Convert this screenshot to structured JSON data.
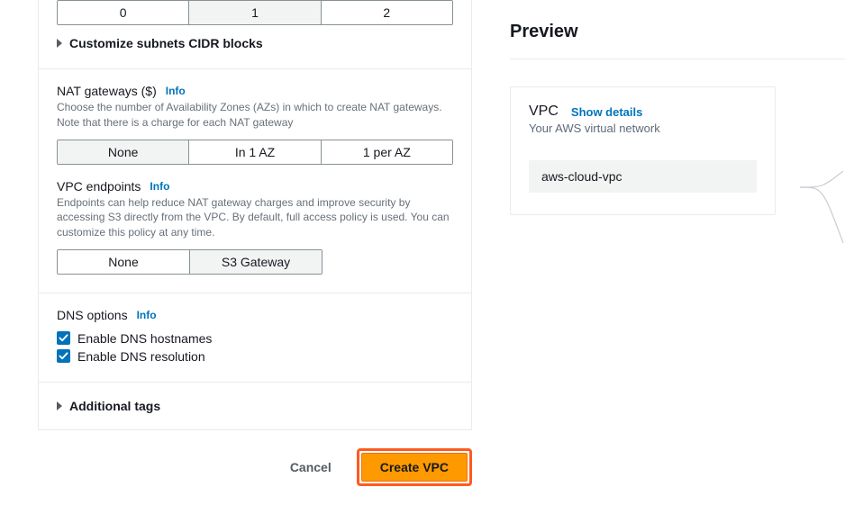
{
  "az_options": [
    "0",
    "1",
    "2"
  ],
  "az_selected_index": 1,
  "customize_subnets_label": "Customize subnets CIDR blocks",
  "nat": {
    "title": "NAT gateways ($)",
    "info": "Info",
    "help": "Choose the number of Availability Zones (AZs) in which to create NAT gateways. Note that there is a charge for each NAT gateway",
    "options": [
      "None",
      "In 1 AZ",
      "1 per AZ"
    ],
    "selected_index": 0
  },
  "endpoints": {
    "title": "VPC endpoints",
    "info": "Info",
    "help": "Endpoints can help reduce NAT gateway charges and improve security by accessing S3 directly from the VPC. By default, full access policy is used. You can customize this policy at any time.",
    "options": [
      "None",
      "S3 Gateway"
    ],
    "selected_index": 1
  },
  "dns": {
    "title": "DNS options",
    "info": "Info",
    "hostnames_label": "Enable DNS hostnames",
    "resolution_label": "Enable DNS resolution"
  },
  "additional_tags_label": "Additional tags",
  "cancel_label": "Cancel",
  "create_label": "Create VPC",
  "preview": {
    "title": "Preview",
    "vpc_label": "VPC",
    "show_details": "Show details",
    "subtext": "Your AWS virtual network",
    "vpc_name": "aws-cloud-vpc"
  }
}
